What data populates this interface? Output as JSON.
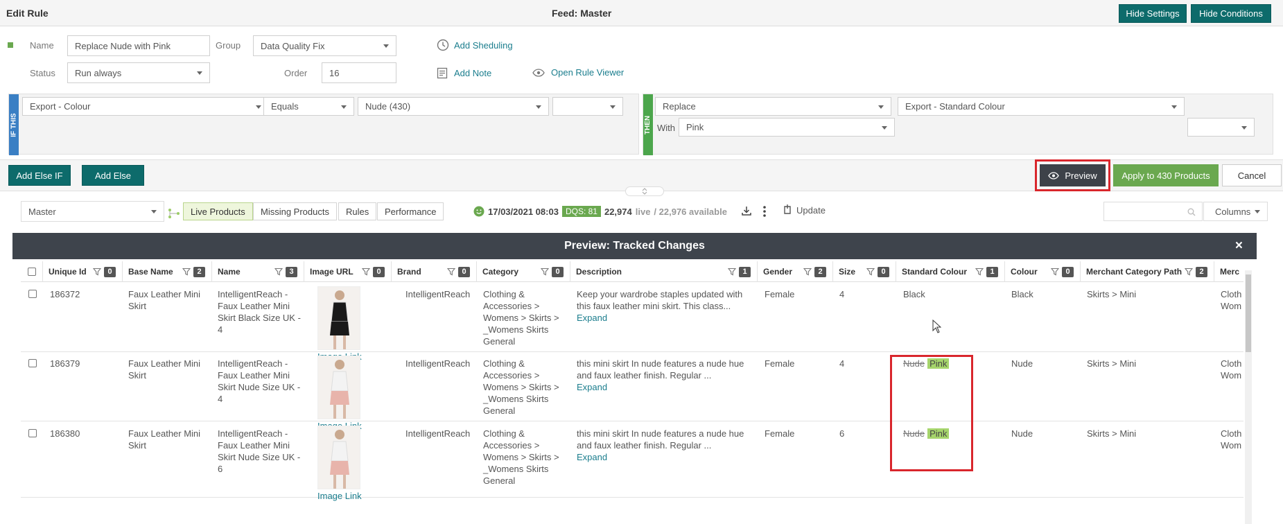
{
  "header": {
    "title": "Edit Rule",
    "feed": "Feed: Master",
    "hide_settings": "Hide Settings",
    "hide_conditions": "Hide Conditions"
  },
  "form": {
    "name_label": "Name",
    "name_value": "Replace Nude with Pink",
    "group_label": "Group",
    "group_value": "Data Quality Fix",
    "status_label": "Status",
    "status_value": "Run always",
    "order_label": "Order",
    "order_value": "16",
    "add_scheduling": "Add Sheduling",
    "add_note": "Add Note",
    "open_rule_viewer": "Open Rule Viewer"
  },
  "if_block": {
    "tag": "IF THIS",
    "field": "Export - Colour",
    "operator": "Equals",
    "value": "Nude (430)",
    "extra": ""
  },
  "then_block": {
    "tag": "THEN",
    "action": "Replace",
    "target": "Export - Standard Colour",
    "with_label": "With",
    "with_value": "Pink",
    "extra": ""
  },
  "actions": {
    "add_else_if": "Add Else IF",
    "add_else": "Add Else",
    "preview": "Preview",
    "apply": "Apply to 430 Products",
    "cancel": "Cancel"
  },
  "toolbar": {
    "feed_select": "Master",
    "tabs": [
      "Live Products",
      "Missing Products",
      "Rules",
      "Performance"
    ],
    "datetime": "17/03/2021 08:03",
    "dqs": "DQS: 81",
    "live_count": "22,974",
    "live_word": "live",
    "available": "/ 22,976 available",
    "update": "Update",
    "search_placeholder": "",
    "columns": "Columns"
  },
  "preview": {
    "title": "Preview: Tracked Changes",
    "close": "×"
  },
  "table": {
    "columns": [
      {
        "label": "Unique Id",
        "count": "0"
      },
      {
        "label": "Base Name",
        "count": "2"
      },
      {
        "label": "Name",
        "count": "3"
      },
      {
        "label": "Image URL",
        "count": "0"
      },
      {
        "label": "Brand",
        "count": "0"
      },
      {
        "label": "Category",
        "count": "0"
      },
      {
        "label": "Description",
        "count": "1"
      },
      {
        "label": "Gender",
        "count": "2"
      },
      {
        "label": "Size",
        "count": "0"
      },
      {
        "label": "Standard Colour",
        "count": "1"
      },
      {
        "label": "Colour",
        "count": "0"
      },
      {
        "label": "Merchant Category Path",
        "count": "2"
      },
      {
        "label": "Merc",
        "count": ""
      }
    ],
    "rows": [
      {
        "id": "186372",
        "base": [
          "Faux Leather Mini",
          "Skirt"
        ],
        "name": [
          "IntelligentReach -",
          "Faux Leather Mini",
          "Skirt Black Size UK -",
          "4"
        ],
        "image_link": "Image Link",
        "brand": "IntelligentReach",
        "category": [
          "Clothing &",
          "Accessories >",
          "Womens > Skirts >",
          "_Womens Skirts",
          "General"
        ],
        "desc": [
          "Keep your wardrobe staples updated with",
          "this faux leather mini skirt. This class..."
        ],
        "expand": "Expand",
        "gender": "Female",
        "size": "4",
        "std_old": "Black",
        "std_new": "",
        "colour": "Black",
        "mcp": "Skirts > Mini",
        "merc": [
          "Cloth",
          "Wom"
        ]
      },
      {
        "id": "186379",
        "base": [
          "Faux Leather Mini",
          "Skirt"
        ],
        "name": [
          "IntelligentReach -",
          "Faux Leather Mini",
          "Skirt Nude Size UK -",
          "4"
        ],
        "image_link": "Image Link",
        "brand": "IntelligentReach",
        "category": [
          "Clothing &",
          "Accessories >",
          "Womens > Skirts >",
          "_Womens Skirts",
          "General"
        ],
        "desc": [
          "this mini skirt In nude features a nude hue",
          "and faux leather finish.    Regular ..."
        ],
        "expand": "Expand",
        "gender": "Female",
        "size": "4",
        "std_old": "Nude",
        "std_new": "Pink",
        "colour": "Nude",
        "mcp": "Skirts > Mini",
        "merc": [
          "Cloth",
          "Wom"
        ]
      },
      {
        "id": "186380",
        "base": [
          "Faux Leather Mini",
          "Skirt"
        ],
        "name": [
          "IntelligentReach -",
          "Faux Leather Mini",
          "Skirt Nude Size UK -",
          "6"
        ],
        "image_link": "Image Link",
        "brand": "IntelligentReach",
        "category": [
          "Clothing &",
          "Accessories >",
          "Womens > Skirts >",
          "_Womens Skirts",
          "General"
        ],
        "desc": [
          "this mini skirt In nude features a nude hue",
          "and faux leather finish.    Regular ..."
        ],
        "expand": "Expand",
        "gender": "Female",
        "size": "6",
        "std_old": "Nude",
        "std_new": "Pink",
        "colour": "Nude",
        "mcp": "Skirts > Mini",
        "merc": [
          "Cloth",
          "Wom"
        ]
      }
    ]
  },
  "colors": {
    "teal": "#0d6b6b",
    "green": "#6aa84f",
    "highlight": "#a6d56c",
    "red_box": "#d9262c",
    "preview_bar": "#3e444c"
  }
}
